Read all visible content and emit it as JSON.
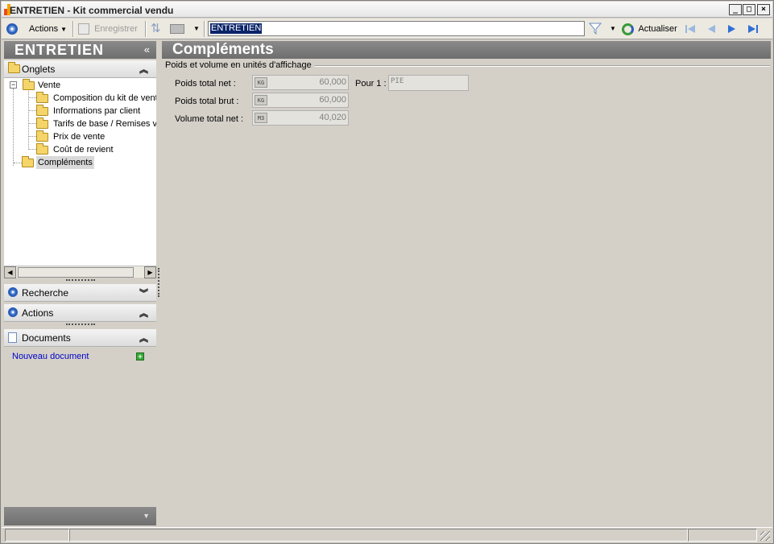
{
  "window": {
    "title": "ENTRETIEN -  Kit commercial vendu",
    "controls": {
      "minimize": "_",
      "maximize": "□",
      "close": "×"
    }
  },
  "toolbar": {
    "actions_label": "Actions",
    "save_label": "Enregistrer",
    "search_value": "ENTRETIEN",
    "refresh_label": "Actualiser"
  },
  "left_panel": {
    "header": "ENTRETIEN",
    "collapse_glyph": "«",
    "sections": {
      "onglets": "Onglets",
      "recherche": "Recherche",
      "actions": "Actions",
      "documents": "Documents"
    },
    "tree": {
      "root": "Vente",
      "children": [
        "Composition du kit de vente",
        "Informations par client",
        "Tarifs de base / Remises vente",
        "Prix de vente",
        "Coût de revient"
      ],
      "sibling": "Compléments"
    },
    "new_document_link": "Nouveau document"
  },
  "main": {
    "title": "Compléments",
    "group_title": "Poids et volume en unités d'affichage",
    "fields": [
      {
        "label": "Poids total net :",
        "unit": "KG",
        "value": "60,000"
      },
      {
        "label": "Poids total brut :",
        "unit": "KG",
        "value": "60,000"
      },
      {
        "label": "Volume total net :",
        "unit": "M3",
        "value": "40,020"
      }
    ],
    "per_label": "Pour 1 :",
    "per_unit": "PIE"
  },
  "colors": {
    "panel_header": "#7c7c7c",
    "selection": "#0a246a",
    "link": "#0000c8",
    "background": "#d4d0c8"
  },
  "icons": [
    "app-logo-icon",
    "actions-ring-icon",
    "save-icon",
    "sync-icon",
    "print-icon",
    "filter-icon",
    "refresh-icon",
    "first-record-icon",
    "previous-record-icon",
    "next-record-icon",
    "last-record-icon",
    "folder-icon",
    "document-icon",
    "add-icon"
  ]
}
